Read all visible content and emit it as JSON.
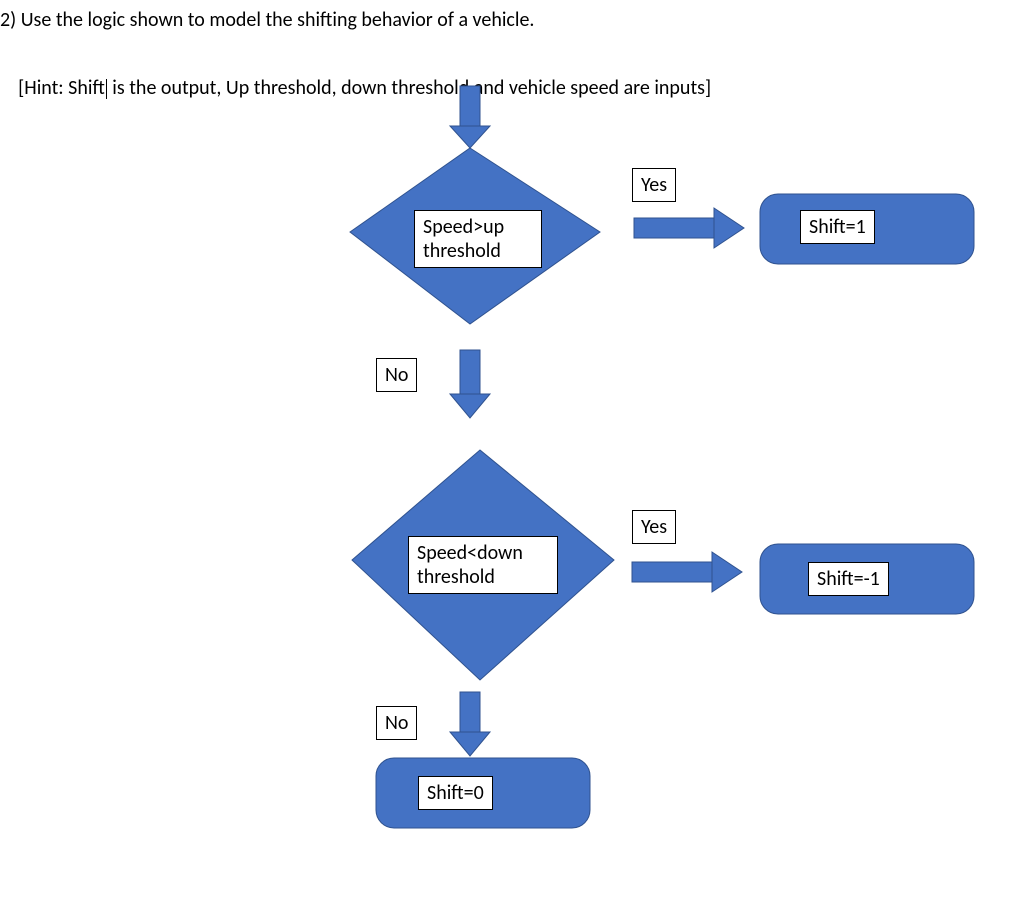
{
  "question": {
    "line1": "2) Use the logic shown to model the shifting behavior of a vehicle.",
    "hint_prefix": "[Hint: Shift",
    "hint_suffix": " is the output, Up threshold, down threshold and vehicle speed are inputs]"
  },
  "flow": {
    "decision1": {
      "line1": "Speed>up",
      "line2": "threshold"
    },
    "decision2": {
      "line1": "Speed<down",
      "line2": "threshold"
    },
    "yes1": "Yes",
    "yes2": "Yes",
    "no1": "No",
    "no2": "No",
    "out_up": "Shift=1",
    "out_down": "Shift=-1",
    "out_zero": "Shift=0"
  },
  "colors": {
    "blue": "#4472C4",
    "outline": "#2F528F"
  }
}
